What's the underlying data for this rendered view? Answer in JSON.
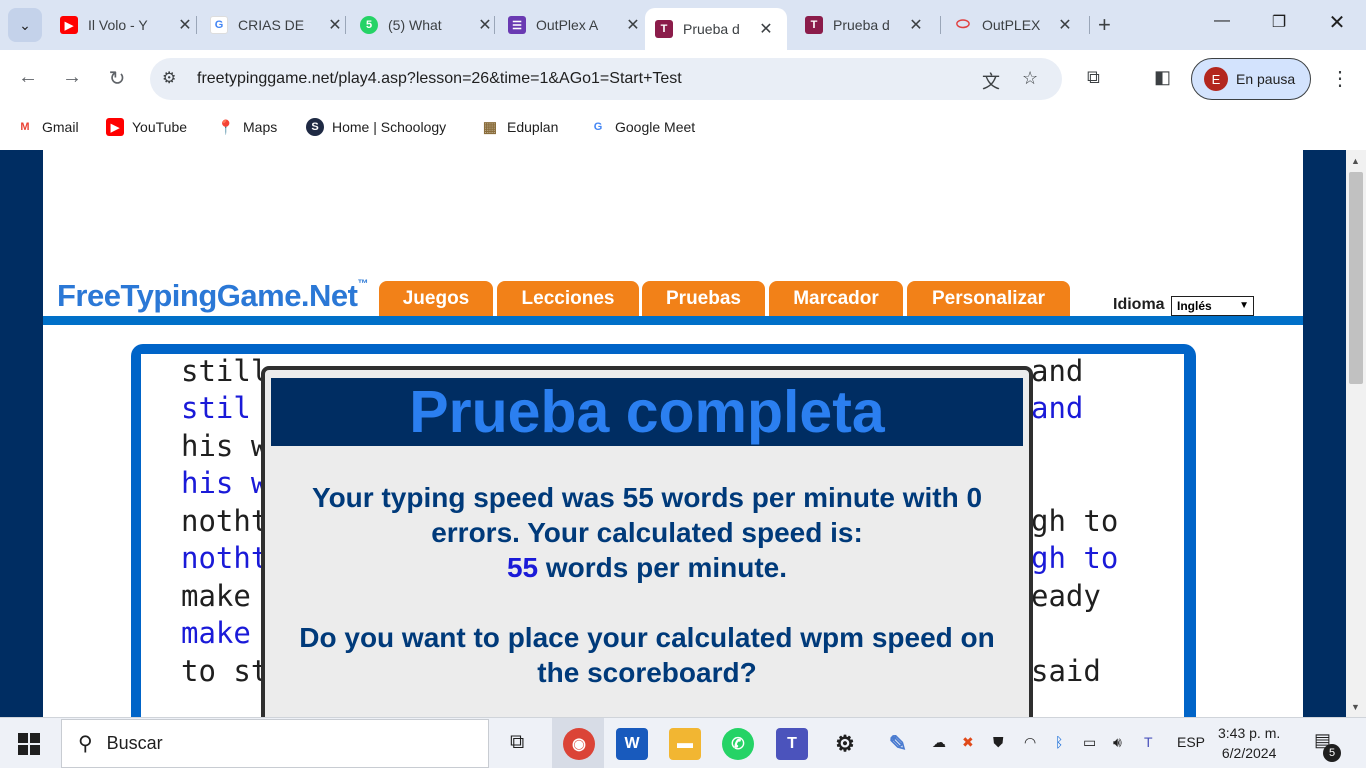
{
  "browser": {
    "tabs": [
      {
        "label": "Il Volo - Y",
        "icon": "youtube-icon",
        "color": "#ff0000",
        "glyph": "▶"
      },
      {
        "label": "CRIAS DE",
        "icon": "google-icon",
        "color": "#4285f4",
        "glyph": "G"
      },
      {
        "label": "(5) What",
        "icon": "whatsapp-icon",
        "color": "#25d366",
        "glyph": "5"
      },
      {
        "label": "OutPlex A",
        "icon": "outplex-list-icon",
        "color": "#6a3ab2",
        "glyph": "☰"
      },
      {
        "label": "Prueba d",
        "icon": "typing-t-icon",
        "color": "#8b1c4a",
        "glyph": "T",
        "active": true
      },
      {
        "label": "Prueba d",
        "icon": "typing-t-icon",
        "color": "#8b1c4a",
        "glyph": "T"
      },
      {
        "label": "OutPLEX",
        "icon": "outplex-oval-icon",
        "color": "#e04040",
        "glyph": "◯"
      }
    ],
    "url": "freetypinggame.net/play4.asp?lesson=26&time=1&AGo1=Start+Test",
    "profile_initial": "E",
    "profile_label": "En pausa",
    "bookmarks": [
      {
        "label": "Gmail",
        "icon": "gmail-icon",
        "color": "#ea4335",
        "glyph": "M"
      },
      {
        "label": "YouTube",
        "icon": "youtube-icon",
        "color": "#ff0000",
        "glyph": "▶"
      },
      {
        "label": "Maps",
        "icon": "maps-pin-icon",
        "color": "#34a853",
        "glyph": "●"
      },
      {
        "label": "Home | Schoology",
        "icon": "schoology-icon",
        "color": "#1f2a44",
        "glyph": "S"
      },
      {
        "label": "Eduplan",
        "icon": "calendar-icon",
        "color": "#8a6d3b",
        "glyph": "▦"
      },
      {
        "label": "Google Meet",
        "icon": "google-icon",
        "color": "#4285f4",
        "glyph": "G"
      }
    ]
  },
  "site": {
    "logo": "FreeTypingGame.Net",
    "logo_tm": "™",
    "nav": [
      "Juegos",
      "Lecciones",
      "Pruebas",
      "Marcador",
      "Personalizar"
    ],
    "lang_label": "Idioma",
    "lang_value": "Inglés"
  },
  "typing": {
    "lines": [
      {
        "text": "still",
        "end": "and",
        "typed": false
      },
      {
        "text": "stil",
        "end": "and",
        "typed": true
      },
      {
        "text": "his w",
        "end": "",
        "typed": false
      },
      {
        "text": "his w",
        "end": "",
        "typed": true
      },
      {
        "text": "notht",
        "end": "gh to",
        "typed": false
      },
      {
        "text": "notht",
        "end": "gh to",
        "typed": true
      },
      {
        "text": "make",
        "end": "eady",
        "typed": false
      },
      {
        "text": "make",
        "end": "",
        "typed": true
      },
      {
        "text": "to st",
        "end": "said",
        "typed": false
      }
    ]
  },
  "dialog": {
    "title": "Prueba completa",
    "msg_line1": "Your typing speed was 55 words per minute with 0",
    "msg_line2": "errors. Your calculated speed is:",
    "speed_value": "55",
    "speed_suffix": " words per minute.",
    "question_line1": "Do you want to place your calculated wpm speed on",
    "question_line2": "the scoreboard?"
  },
  "taskbar": {
    "search_placeholder": "Buscar",
    "lang": "ESP",
    "time": "3:43 p. m.",
    "date": "6/2/2024",
    "notification_count": "5"
  }
}
